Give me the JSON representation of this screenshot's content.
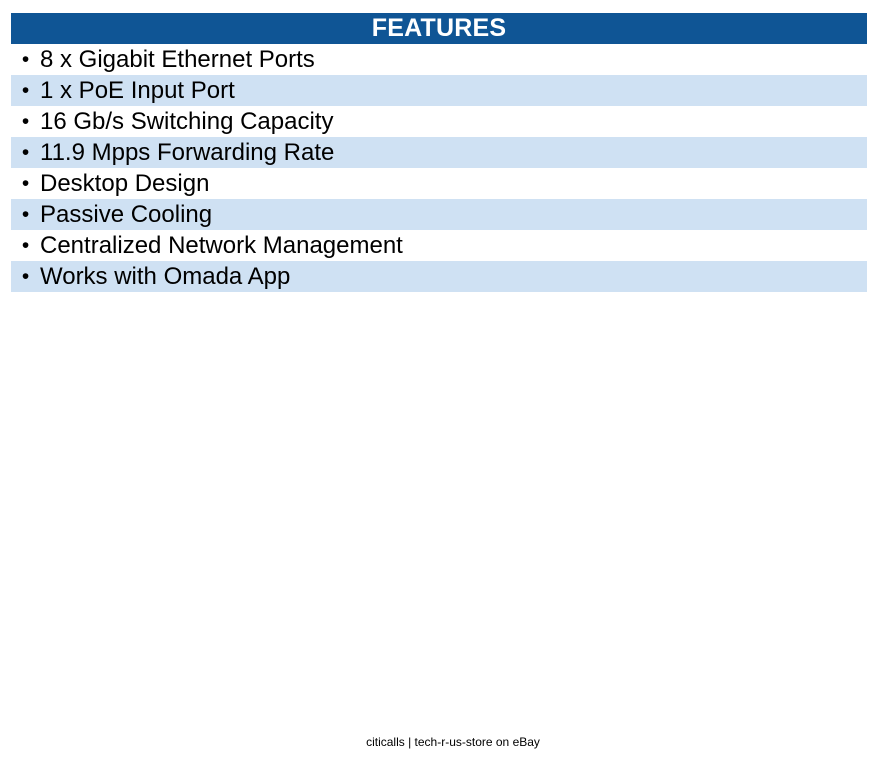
{
  "features": {
    "title": "FEATURES",
    "bullet_glyph": "•",
    "items": [
      "8 x Gigabit Ethernet Ports",
      "1 x PoE Input Port",
      "16 Gb/s Switching Capacity",
      "11.9 Mpps Forwarding Rate",
      "Desktop Design",
      "Passive Cooling",
      "Centralized Network Management",
      "Works with Omada App"
    ],
    "colors": {
      "header_bg": "#0f5595",
      "header_text": "#ffffff",
      "alt_row_bg": "#cfe1f3"
    }
  },
  "footer": {
    "text": "citicalls | tech-r-us-store on eBay"
  }
}
